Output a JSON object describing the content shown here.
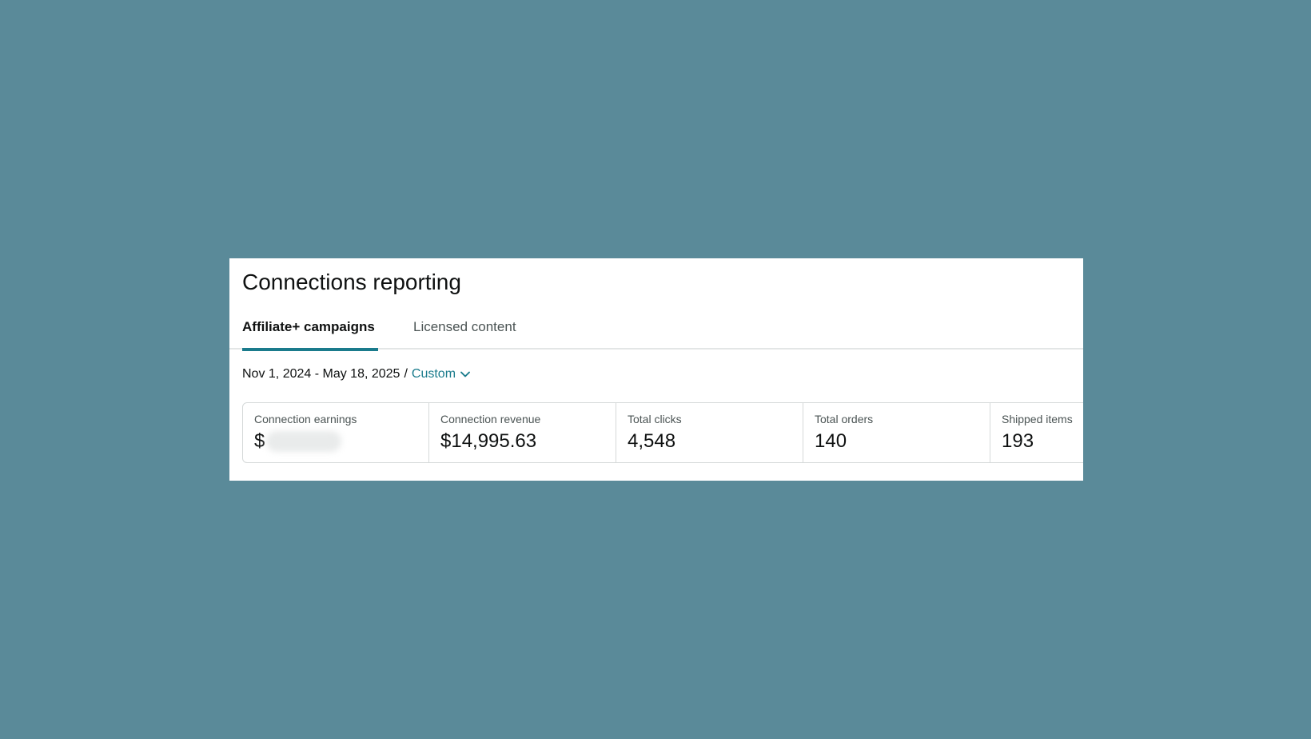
{
  "page": {
    "title": "Connections reporting"
  },
  "tabs": [
    {
      "label": "Affiliate+ campaigns",
      "active": true
    },
    {
      "label": "Licensed content",
      "active": false
    }
  ],
  "date_range": {
    "text": "Nov 1, 2024 - May 18, 2025",
    "separator": "/",
    "selector_label": "Custom",
    "selector_icon": "chevron-down-icon"
  },
  "metrics": [
    {
      "label": "Connection earnings",
      "value": "$",
      "redacted": true
    },
    {
      "label": "Connection revenue",
      "value": "$14,995.63"
    },
    {
      "label": "Total clicks",
      "value": "4,548"
    },
    {
      "label": "Total orders",
      "value": "140"
    },
    {
      "label": "Shipped items",
      "value": "193"
    }
  ],
  "colors": {
    "background": "#5a8a99",
    "accent": "#1a7b8c",
    "text": "#0f1111",
    "muted_text": "#4b5454",
    "border": "#d5d9d9"
  }
}
